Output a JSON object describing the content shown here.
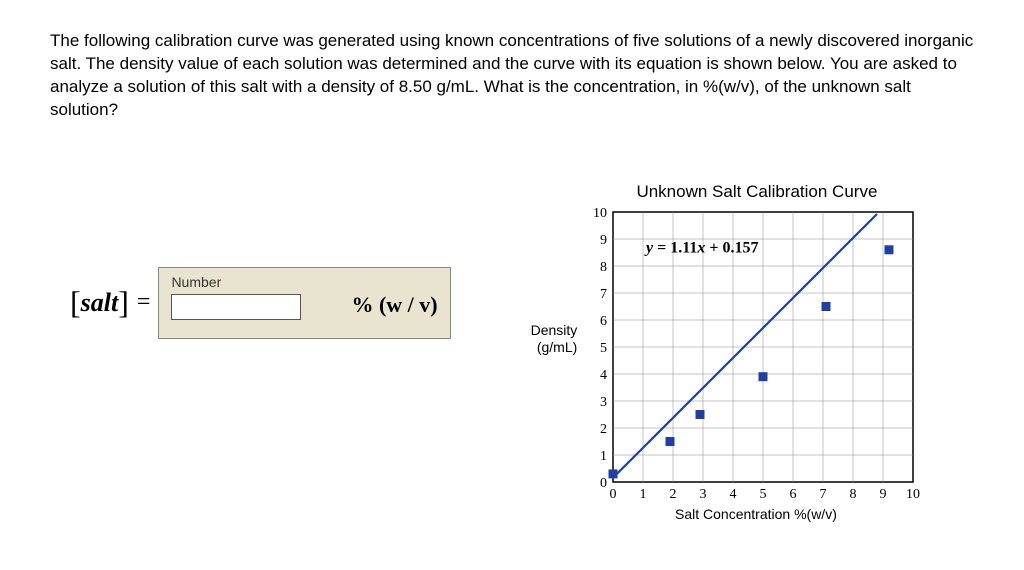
{
  "question_text": "The following calibration curve was generated using known concentrations of five solutions of a newly discovered inorganic salt. The density value of each solution was determined and the curve with its equation is shown below. You are asked to analyze a solution of this salt with a density of 8.50 g/mL. What is the concentration, in %(w/v), of the unknown salt solution?",
  "input": {
    "prefix_open": "[",
    "salt_label": "salt",
    "prefix_close": "]",
    "equals": "=",
    "number_label": "Number",
    "unit_label": "%  (w / v)",
    "value": ""
  },
  "chart_data": {
    "type": "scatter_with_line",
    "title": "Unknown Salt Calibration Curve",
    "xlabel": "Salt Concentration %(w/v)",
    "ylabel": "Density (g/mL)",
    "xlim": [
      0,
      10
    ],
    "ylim": [
      0,
      10
    ],
    "x_ticks": [
      0,
      1,
      2,
      3,
      4,
      5,
      6,
      7,
      8,
      9,
      10
    ],
    "y_ticks": [
      0,
      1,
      2,
      3,
      4,
      5,
      6,
      7,
      8,
      9,
      10
    ],
    "equation": "y = 1.11x + 0.157",
    "equation_parts": {
      "pre": "y",
      "eq": " = 1.11",
      "xvar": "x",
      "post": " + 0.157"
    },
    "line": {
      "slope": 1.11,
      "intercept": 0.157,
      "x0": 0,
      "x1": 8.8
    },
    "points": [
      {
        "x": 0.0,
        "y": 0.3
      },
      {
        "x": 1.9,
        "y": 1.5
      },
      {
        "x": 2.9,
        "y": 2.5
      },
      {
        "x": 5.0,
        "y": 3.9
      },
      {
        "x": 7.1,
        "y": 6.5
      },
      {
        "x": 9.2,
        "y": 8.6
      }
    ],
    "colors": {
      "grid": "#888888",
      "axis": "#000000",
      "line": "#2040a0",
      "marker": "#2040a0"
    }
  }
}
